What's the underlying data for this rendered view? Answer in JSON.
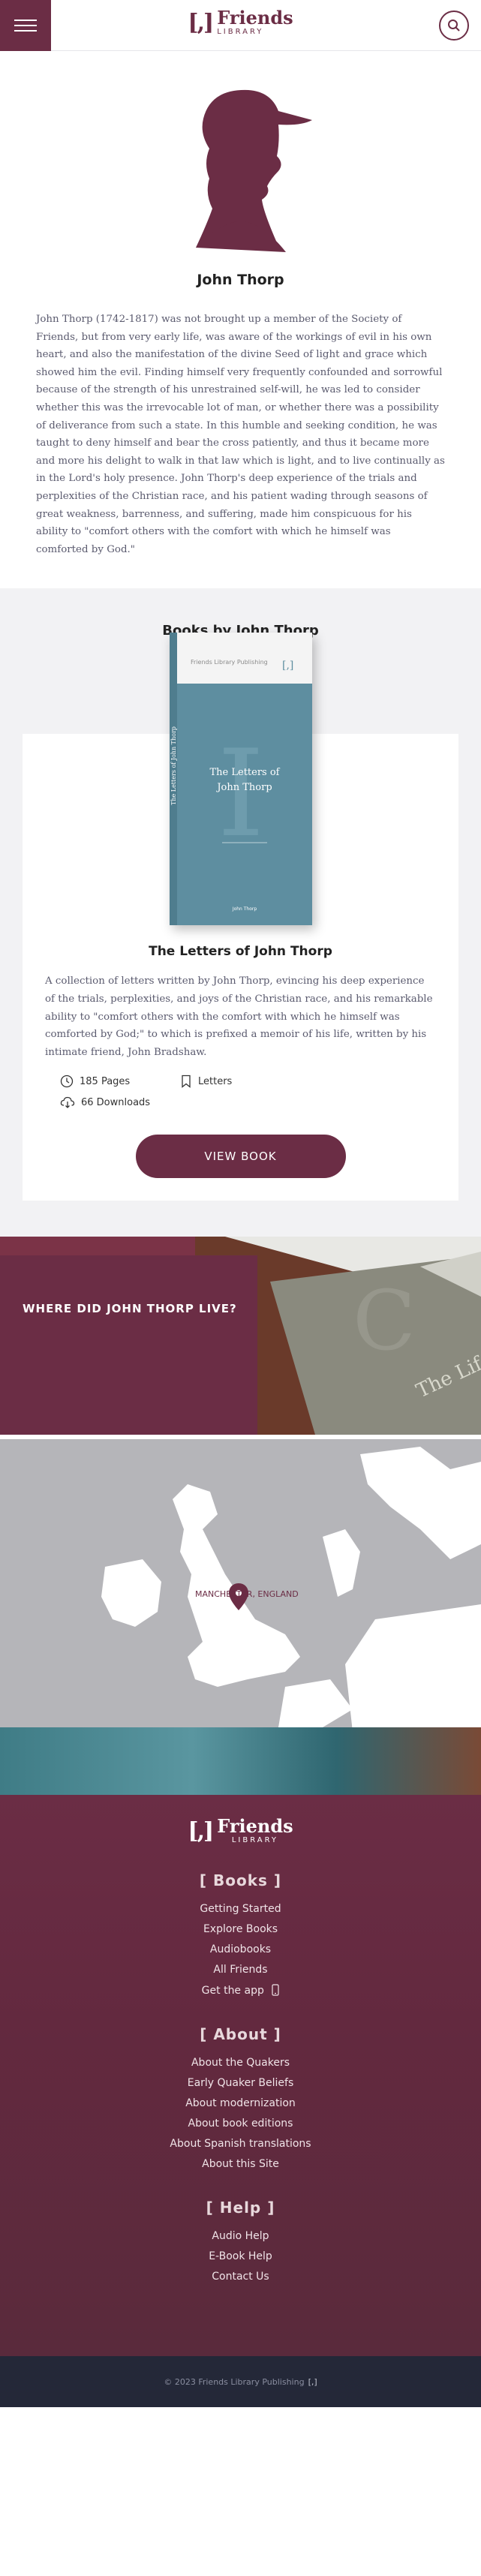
{
  "header": {
    "logo_mark": "[,]",
    "logo_title": "Friends",
    "logo_subtitle": "LIBRARY",
    "menu_icon": "hamburger-icon",
    "search_icon": "search-icon"
  },
  "profile": {
    "name": "John Thorp",
    "bio": "John Thorp (1742-1817) was not brought up a member of the Society of Friends, but from very early life, was aware of the workings of evil in his own heart, and also the manifestation of the divine Seed of light and grace which showed him the evil. Finding himself very frequently confounded and sorrowful because of the strength of his unrestrained self-will, he was led to consider whether this was the irrevocable lot of man, or whether there was a possibility of deliverance from such a state. In this humble and seeking condition, he was taught to deny himself and bear the cross patiently, and thus it became more and more his delight to walk in that law which is light, and to live continually as in the Lord's holy presence. John Thorp's deep experience of the trials and perplexities of the Christian race, and his patient wading through seasons of great weakness, barrenness, and suffering, made him conspicuous for his ability to \"comfort others with the comfort with which he himself was comforted by God.\""
  },
  "books": {
    "heading": "Books by John Thorp",
    "items": [
      {
        "cover_publisher": "Friends Library Publishing",
        "cover_title_line1": "The Letters of",
        "cover_title_line2": "John Thorp",
        "cover_author": "John Thorp",
        "title": "The Letters of John Thorp",
        "description": "A collection of letters written by John Thorp, evincing his deep experience of the trials, perplexities, and joys of the Christian race, and his remarkable ability to \"comfort others with the comfort with which he himself was comforted by God;\" to which is prefixed a memoir of his life, written by his intimate friend, John Bradshaw.",
        "pages": "185 Pages",
        "type": "Letters",
        "downloads": "66 Downloads",
        "button": "VIEW BOOK"
      }
    ]
  },
  "where": {
    "title": "WHERE DID JOHN THORP LIVE?",
    "bg_book_text": "The Life"
  },
  "map": {
    "location": "MANCHESTER, ENGLAND"
  },
  "footer": {
    "logo_mark": "[,]",
    "logo_title": "Friends",
    "logo_subtitle": "LIBRARY",
    "groups": [
      {
        "heading": "[ Books ]",
        "links": [
          "Getting Started",
          "Explore Books",
          "Audiobooks",
          "All Friends",
          "Get the app"
        ]
      },
      {
        "heading": "[ About ]",
        "links": [
          "About the Quakers",
          "Early Quaker Beliefs",
          "About modernization",
          "About book editions",
          "About Spanish translations",
          "About this Site"
        ]
      },
      {
        "heading": "[ Help ]",
        "links": [
          "Audio Help",
          "E-Book Help",
          "Contact Us"
        ]
      }
    ],
    "copyright": "© 2023 Friends Library Publishing",
    "copyright_mark": "[,]"
  },
  "colors": {
    "brand": "#6b2d45",
    "dark": "#242838",
    "cover_blue": "#5e8ea0"
  }
}
